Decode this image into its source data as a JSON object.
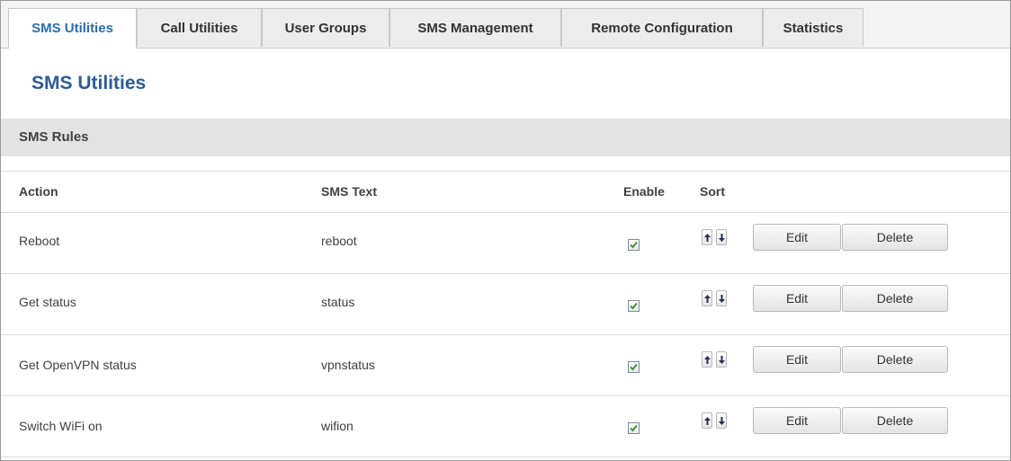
{
  "tabs": [
    {
      "label": "SMS Utilities",
      "active": true
    },
    {
      "label": "Call Utilities",
      "active": false
    },
    {
      "label": "User Groups",
      "active": false
    },
    {
      "label": "SMS Management",
      "active": false
    },
    {
      "label": "Remote Configuration",
      "active": false
    },
    {
      "label": "Statistics",
      "active": false
    }
  ],
  "page": {
    "title": "SMS Utilities"
  },
  "section": {
    "title": "SMS Rules"
  },
  "table": {
    "headers": {
      "action": "Action",
      "sms_text": "SMS Text",
      "enable": "Enable",
      "sort": "Sort"
    },
    "rows": [
      {
        "action": "Reboot",
        "sms_text": "reboot",
        "enabled": true,
        "edit_label": "Edit",
        "delete_label": "Delete"
      },
      {
        "action": "Get status",
        "sms_text": "status",
        "enabled": true,
        "edit_label": "Edit",
        "delete_label": "Delete"
      },
      {
        "action": "Get OpenVPN status",
        "sms_text": "vpnstatus",
        "enabled": true,
        "edit_label": "Edit",
        "delete_label": "Delete"
      },
      {
        "action": "Switch WiFi on",
        "sms_text": "wifion",
        "enabled": true,
        "edit_label": "Edit",
        "delete_label": "Delete"
      }
    ]
  },
  "colors": {
    "accent": "#2a6cb4",
    "title": "#2d5c98",
    "check": "#3a8a2a"
  }
}
